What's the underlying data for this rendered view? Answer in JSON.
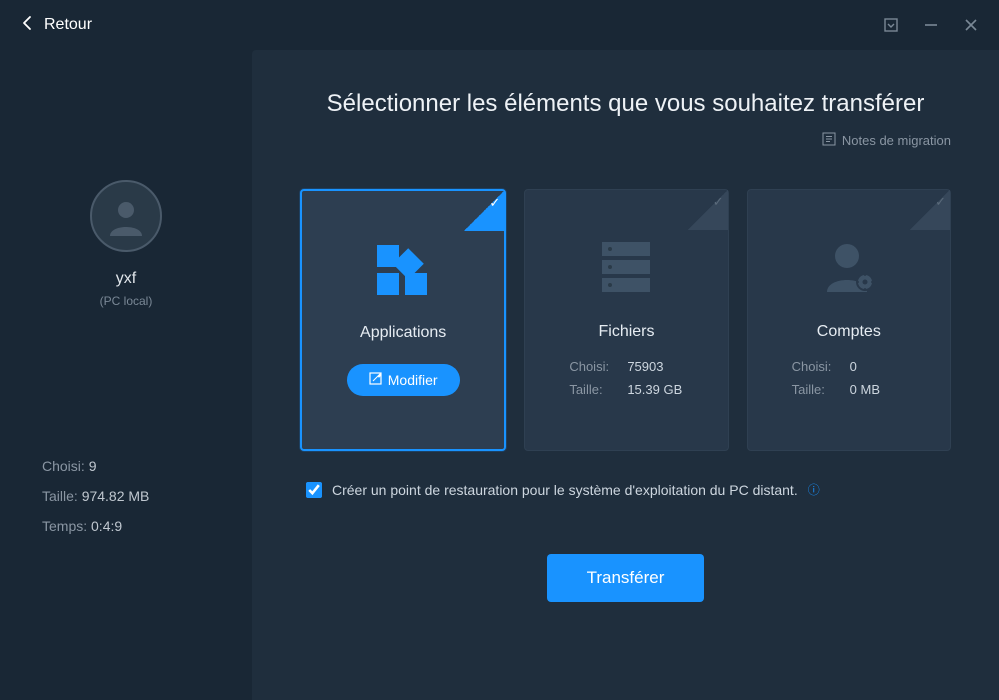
{
  "titlebar": {
    "back_label": "Retour"
  },
  "sidebar": {
    "username": "yxf",
    "pc_label": "(PC local)",
    "stats": {
      "choisi_label": "Choisi:",
      "choisi_value": "9",
      "taille_label": "Taille:",
      "taille_value": "974.82 MB",
      "temps_label": "Temps:",
      "temps_value": "0:4:9"
    }
  },
  "content": {
    "title": "Sélectionner les éléments que vous souhaitez transférer",
    "migration_notes": "Notes de migration",
    "cards": {
      "applications": {
        "title": "Applications",
        "modify_label": "Modifier"
      },
      "fichiers": {
        "title": "Fichiers",
        "choisi_label": "Choisi:",
        "choisi_value": "75903",
        "taille_label": "Taille:",
        "taille_value": "15.39 GB"
      },
      "comptes": {
        "title": "Comptes",
        "choisi_label": "Choisi:",
        "choisi_value": "0",
        "taille_label": "Taille:",
        "taille_value": "0 MB"
      }
    },
    "restore_checkbox_label": "Créer un point de restauration pour le système d'exploitation du PC distant.",
    "transfer_button": "Transférer"
  }
}
